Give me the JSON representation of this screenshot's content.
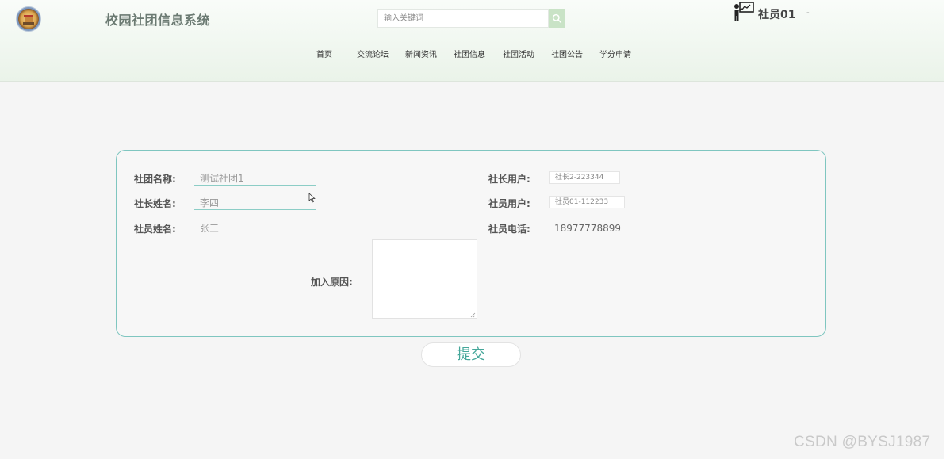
{
  "header": {
    "site_title": "校园社团信息系统",
    "search_placeholder": "输入关键词",
    "user_name": "社员01",
    "user_caret": "-",
    "nav": [
      "首页",
      "交流论坛",
      "新闻资讯",
      "社团信息",
      "社团活动",
      "社团公告",
      "学分申请"
    ]
  },
  "form": {
    "club_name_label": "社团名称:",
    "club_name_value": "测试社团1",
    "president_name_label": "社长姓名:",
    "president_name_value": "李四",
    "member_name_label": "社员姓名:",
    "member_name_value": "张三",
    "president_user_label": "社长用户:",
    "president_user_value": "社长2-223344",
    "member_user_label": "社员用户:",
    "member_user_value": "社员01-112233",
    "member_phone_label": "社员电话:",
    "member_phone_value": "18977778899",
    "reason_label": "加入原因:",
    "reason_value": "",
    "submit_label": "提交"
  },
  "watermark": "CSDN @BYSJ1987",
  "colors": {
    "accent": "#45a79a",
    "panel_border": "#7fc6c0",
    "header_bg": "#eaf3e9",
    "search_button": "#c9e3c6"
  },
  "icons": [
    "logo-emblem",
    "search-icon",
    "teacher-user-icon",
    "resize-grip-icon",
    "mouse-cursor-icon"
  ]
}
